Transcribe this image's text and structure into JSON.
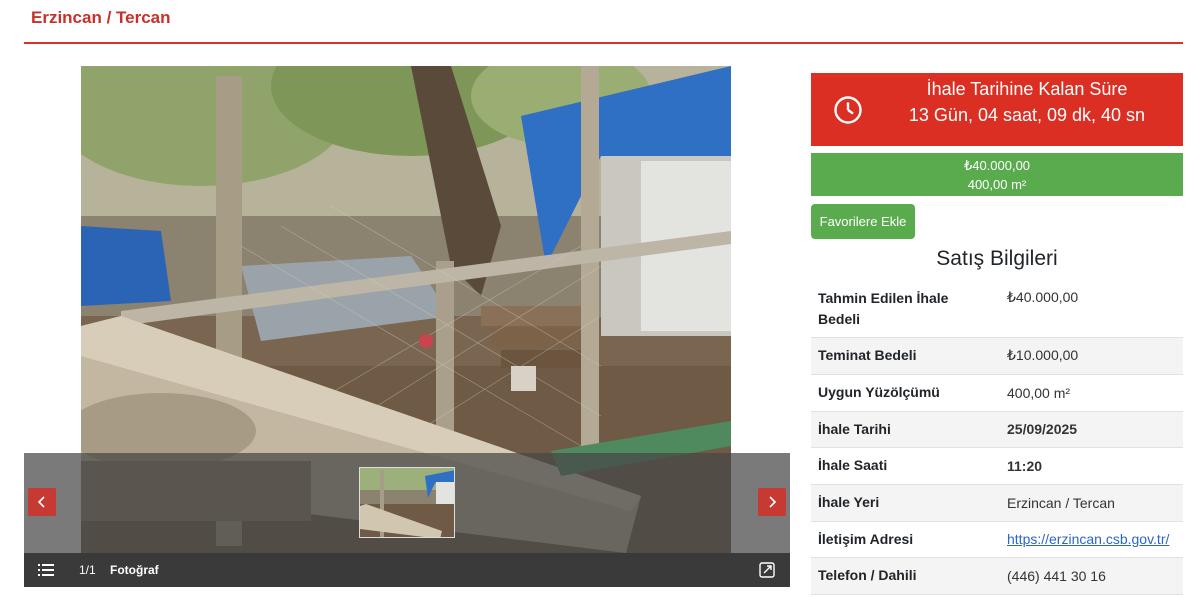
{
  "page": {
    "location_title": "Erzincan / Tercan"
  },
  "gallery": {
    "prev_icon": "chevron-left-icon",
    "next_icon": "chevron-right-icon",
    "counter": "1/1",
    "caption": "Fotoğraf",
    "list_icon": "list-icon",
    "fullscreen_icon": "expand-icon"
  },
  "countdown": {
    "title": "İhale Tarihine Kalan Süre",
    "value": "13 Gün, 04 saat, 09 dk, 40 sn",
    "icon": "clock-icon",
    "bg_color": "#dc2f24"
  },
  "price": {
    "amount": "₺40.000,00",
    "area": "400,00 m²",
    "bg_color": "#5aaa4e"
  },
  "favorite_button": "Favorilere Ekle",
  "sale_info": {
    "title": "Satış Bilgileri",
    "rows": [
      {
        "label": "Tahmin Edilen İhale Bedeli",
        "value": "₺40.000,00"
      },
      {
        "label": "Teminat Bedeli",
        "value": "₺10.000,00"
      },
      {
        "label": "Uygun Yüzölçümü",
        "value": "400,00 m²"
      },
      {
        "label": "İhale Tarihi",
        "value": "25/09/2025"
      },
      {
        "label": "İhale Saati",
        "value": "11:20"
      },
      {
        "label": "İhale Yeri",
        "value": "Erzincan / Tercan"
      },
      {
        "label": "İletişim Adresi",
        "value": "https://erzincan.csb.gov.tr/"
      },
      {
        "label": "Telefon / Dahili",
        "value": "(446) 441 30 16"
      }
    ]
  }
}
